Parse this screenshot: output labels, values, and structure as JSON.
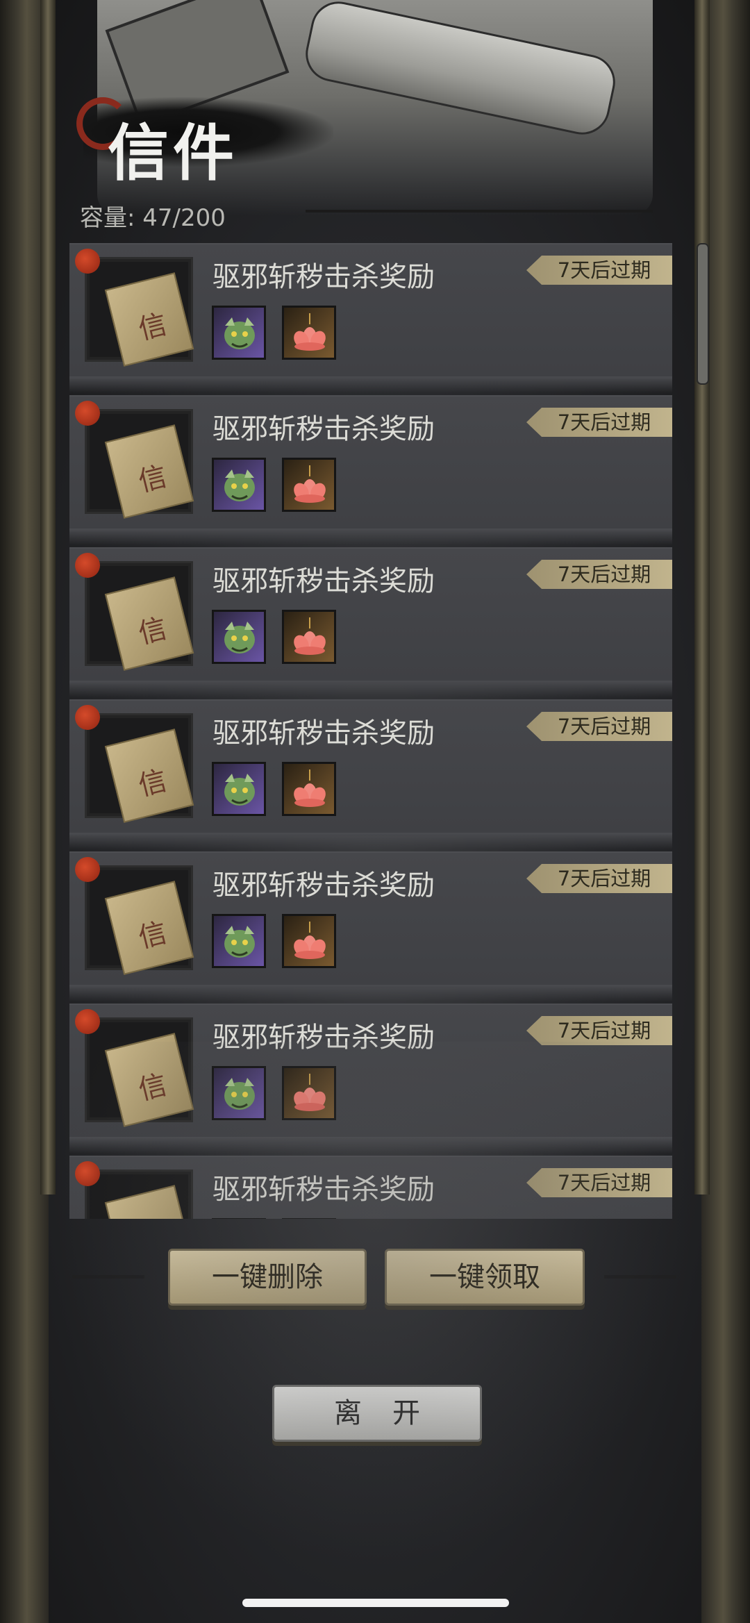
{
  "header": {
    "title": "信件",
    "capacity_label": "容量:",
    "capacity_value": "47/200"
  },
  "mails": [
    {
      "title": "驱邪斩秽击杀奖励",
      "expiry": "7天后过期",
      "rewards": [
        "dragon-mask-icon",
        "lotus-icon"
      ]
    },
    {
      "title": "驱邪斩秽击杀奖励",
      "expiry": "7天后过期",
      "rewards": [
        "dragon-mask-icon",
        "lotus-icon"
      ]
    },
    {
      "title": "驱邪斩秽击杀奖励",
      "expiry": "7天后过期",
      "rewards": [
        "dragon-mask-icon",
        "lotus-icon"
      ]
    },
    {
      "title": "驱邪斩秽击杀奖励",
      "expiry": "7天后过期",
      "rewards": [
        "dragon-mask-icon",
        "lotus-icon"
      ]
    },
    {
      "title": "驱邪斩秽击杀奖励",
      "expiry": "7天后过期",
      "rewards": [
        "dragon-mask-icon",
        "lotus-icon"
      ]
    },
    {
      "title": "驱邪斩秽击杀奖励",
      "expiry": "7天后过期",
      "rewards": [
        "dragon-mask-icon",
        "lotus-icon"
      ]
    },
    {
      "title": "驱邪斩秽击杀奖励",
      "expiry": "7天后过期",
      "rewards": [
        "dragon-mask-icon",
        "lotus-icon"
      ]
    }
  ],
  "actions": {
    "delete_all": "一键删除",
    "claim_all": "一键领取",
    "leave": "离开"
  },
  "colors": {
    "seal": "#c2401f",
    "badge": "#b3a67f",
    "button": "#c2b592"
  }
}
